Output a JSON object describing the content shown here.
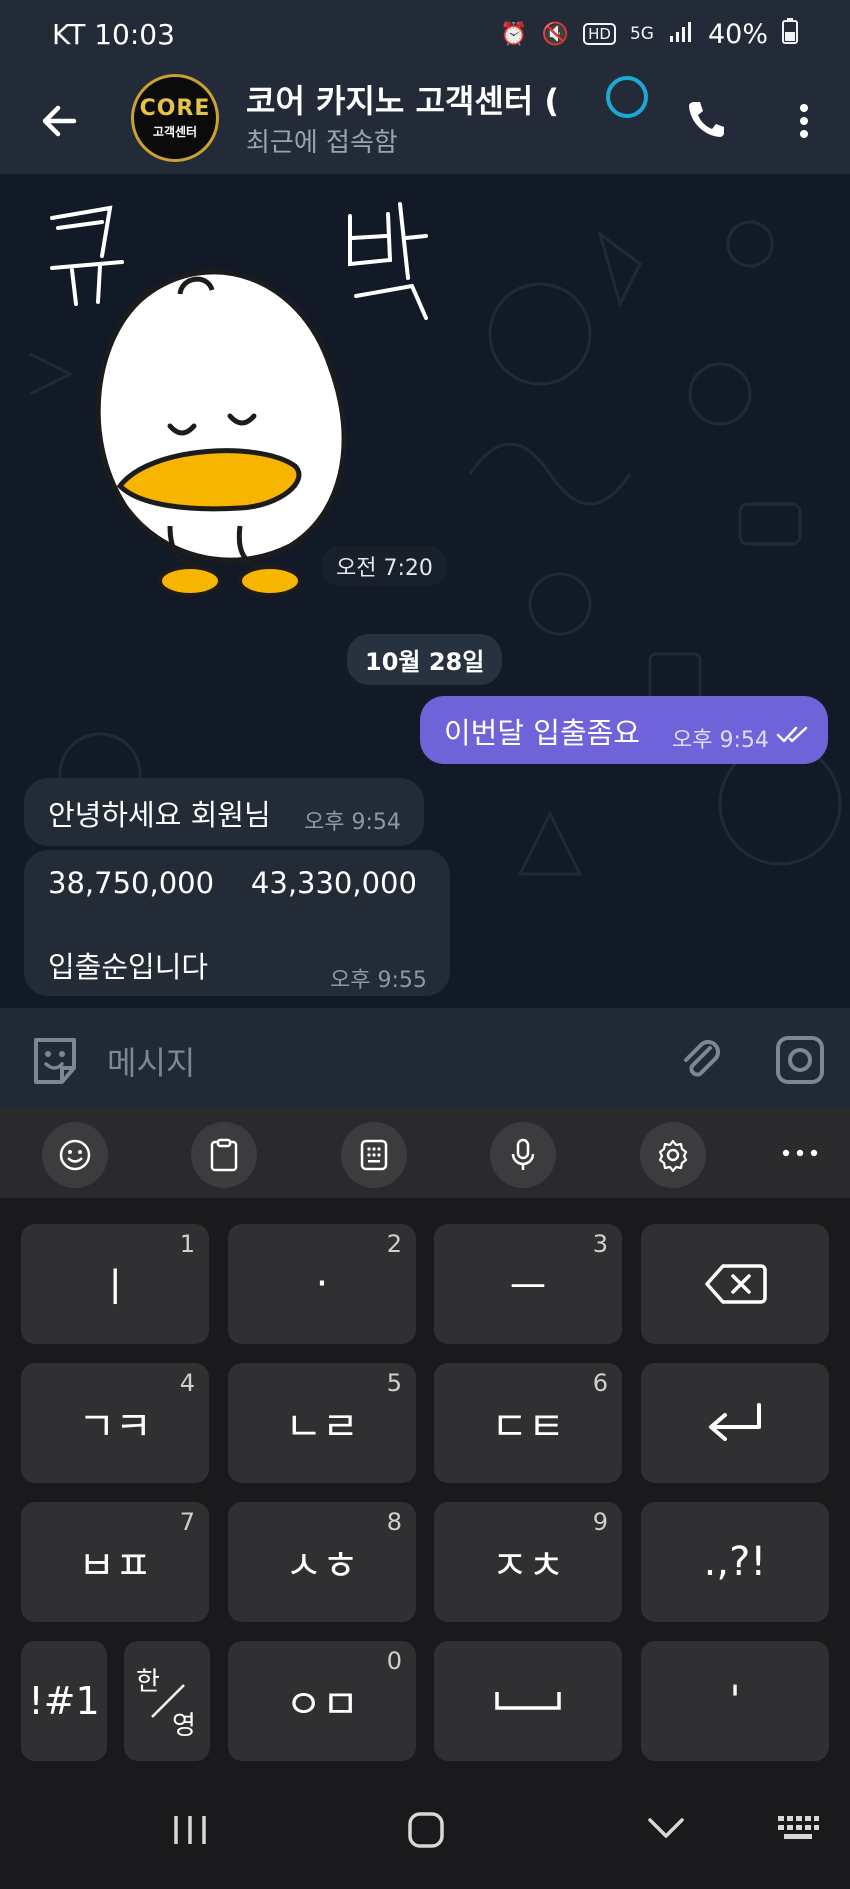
{
  "status_bar": {
    "carrier_time": "KT 10:03",
    "battery": "40%"
  },
  "header": {
    "title": "코어 카지노 고객센터 (",
    "subtitle": "최근에 접속함",
    "avatar_logo": "CORE",
    "avatar_sub": "고객센터"
  },
  "sticker": {
    "text": "꾸 벅",
    "time": "오전 7:20"
  },
  "date_divider": "10월 28일",
  "messages": [
    {
      "direction": "out",
      "text": "이번달 입출좀요",
      "time": "오후 9:54"
    },
    {
      "direction": "in",
      "text": "안녕하세요 회원님",
      "time": "오후 9:54"
    },
    {
      "direction": "in",
      "line1": "38,750,000    43,330,000",
      "line2": "입출순입니다",
      "time": "오후 9:55"
    }
  ],
  "composer": {
    "placeholder": "메시지"
  },
  "keyboard": {
    "keys": [
      {
        "label": "ㅣ",
        "num": "1"
      },
      {
        "label": "·",
        "num": "2"
      },
      {
        "label": "ㅡ",
        "num": "3"
      },
      {
        "label": "ㄱㅋ",
        "num": "4"
      },
      {
        "label": "ㄴㄹ",
        "num": "5"
      },
      {
        "label": "ㄷㅌ",
        "num": "6"
      },
      {
        "label": "ㅂㅍ",
        "num": "7"
      },
      {
        "label": "ㅅㅎ",
        "num": "8"
      },
      {
        "label": "ㅈㅊ",
        "num": "9"
      },
      {
        "label": ".,?!"
      },
      {
        "label": "!#1"
      },
      {
        "label_top": "한",
        "label_bottom": "영"
      },
      {
        "label": "ㅇㅁ",
        "num": "0"
      },
      {
        "label": "'"
      }
    ]
  },
  "colors": {
    "accent": "#6f63d9",
    "header_bg": "#232b38",
    "chat_bg": "#111a26"
  }
}
